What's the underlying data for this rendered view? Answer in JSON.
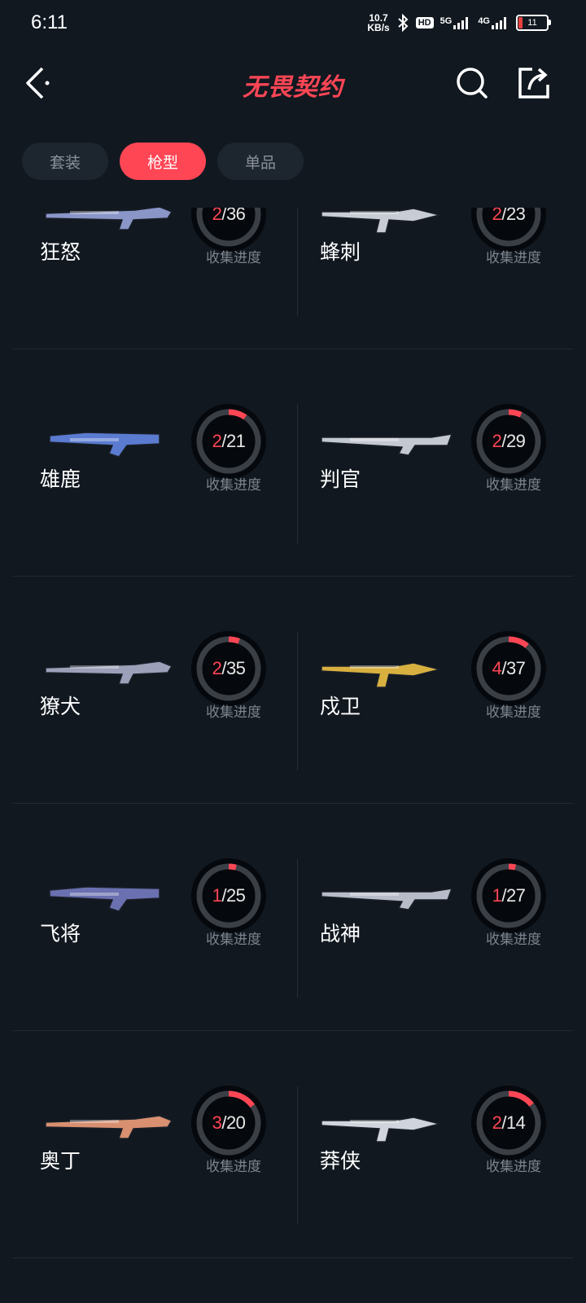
{
  "status": {
    "time": "6:11",
    "net_speed_value": "10.7",
    "net_speed_unit": "KB/s",
    "hd_label": "HD",
    "sig1_label": "5G",
    "sig2_label": "4G",
    "battery": "11"
  },
  "header": {
    "title": "无畏契约",
    "back_icon": "chevron-left-icon",
    "search_icon": "search-icon",
    "share_icon": "share-icon"
  },
  "tabs": [
    {
      "label": "套装",
      "active": false
    },
    {
      "label": "枪型",
      "active": true
    },
    {
      "label": "单品",
      "active": false
    }
  ],
  "progress_label": "收集进度",
  "colors": {
    "accent": "#ff4655",
    "background": "#111820",
    "tab_bg": "#1d252f"
  },
  "weapons": [
    {
      "name": "狂怒",
      "collected": 2,
      "total": 36
    },
    {
      "name": "蜂刺",
      "collected": 2,
      "total": 23
    },
    {
      "name": "雄鹿",
      "collected": 2,
      "total": 21
    },
    {
      "name": "判官",
      "collected": 2,
      "total": 29
    },
    {
      "name": "獠犬",
      "collected": 2,
      "total": 35
    },
    {
      "name": "戍卫",
      "collected": 4,
      "total": 37
    },
    {
      "name": "飞将",
      "collected": 1,
      "total": 25
    },
    {
      "name": "战神",
      "collected": 1,
      "total": 27
    },
    {
      "name": "奥丁",
      "collected": 3,
      "total": 20
    },
    {
      "name": "莽侠",
      "collected": 2,
      "total": 14
    }
  ]
}
